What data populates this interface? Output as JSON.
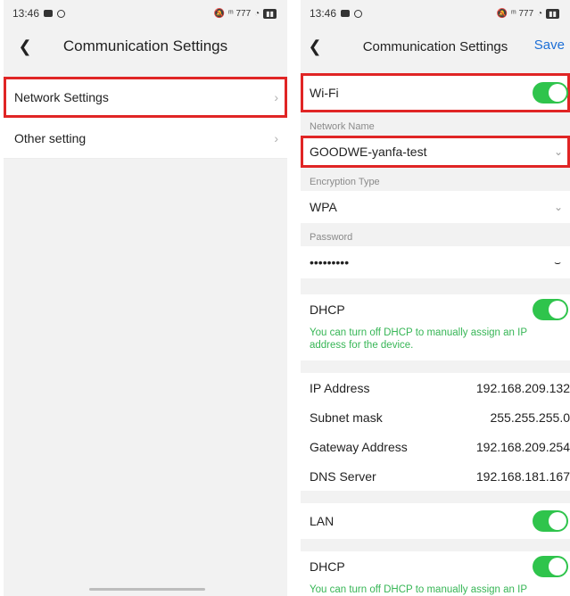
{
  "left": {
    "status": {
      "time": "13:46",
      "right_text": "ᵐ 777"
    },
    "nav": {
      "title": "Communication Settings"
    },
    "items": [
      {
        "label": "Network Settings"
      },
      {
        "label": "Other setting"
      }
    ]
  },
  "right": {
    "status": {
      "time": "13:46",
      "right_text": "ᵐ 777"
    },
    "nav": {
      "title": "Communication Settings",
      "save": "Save"
    },
    "wifi": {
      "label": "Wi-Fi",
      "on": true
    },
    "network_name": {
      "label": "Network Name",
      "value": "GOODWE-yanfa-test"
    },
    "encryption": {
      "label": "Encryption Type",
      "value": "WPA"
    },
    "password": {
      "label": "Password",
      "value": "•••••••••"
    },
    "dhcp": {
      "label": "DHCP",
      "on": true,
      "note": "You can turn off DHCP to manually assign an IP address for the device."
    },
    "ip": {
      "label": "IP Address",
      "value": "192.168.209.132"
    },
    "subnet": {
      "label": "Subnet mask",
      "value": "255.255.255.0"
    },
    "gateway": {
      "label": "Gateway Address",
      "value": "192.168.209.254"
    },
    "dns": {
      "label": "DNS Server",
      "value": "192.168.181.167"
    },
    "lan": {
      "label": "LAN",
      "on": true
    },
    "dhcp2": {
      "label": "DHCP",
      "on": true,
      "note": "You can turn off DHCP to manually assign an IP"
    }
  },
  "colors": {
    "highlight": "#e02525",
    "toggle_on": "#2fc44c",
    "link": "#1d6fd6",
    "note": "#37b656"
  }
}
